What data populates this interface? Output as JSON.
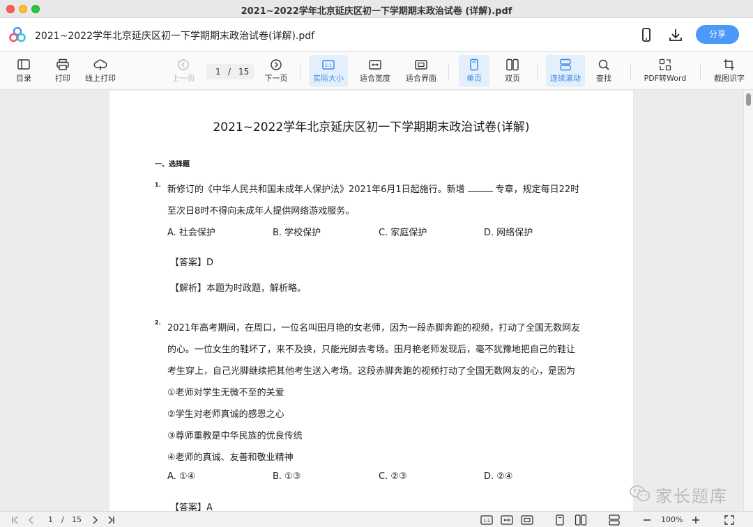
{
  "window": {
    "title": "2021~2022学年北京延庆区初一下学期期末政治试卷 (详解).pdf"
  },
  "header": {
    "doc_title": "2021~2022学年北京延庆区初一下学期期末政治试卷(详解).pdf",
    "share_label": "分享"
  },
  "toolbar": {
    "toc": "目录",
    "print": "打印",
    "online_print": "线上打印",
    "prev_page": "上一页",
    "current_page": "1",
    "page_sep": "/",
    "total_pages": "15",
    "next_page": "下一页",
    "actual_size": "实际大小",
    "fit_width": "适合宽度",
    "fit_page": "适合界面",
    "single_page": "单页",
    "double_page": "双页",
    "continuous_scroll": "连续滚动",
    "search": "查找",
    "pdf_to_word": "PDF转Word",
    "screenshot_ocr": "截图识字"
  },
  "document": {
    "title": "2021~2022学年北京延庆区初一下学期期末政治试卷(详解)",
    "section": "一、选择题",
    "q1": {
      "num": "1.",
      "line1a": "新修订的《中华人民共和国未成年人保护法》2021年6月1日起施行。新增",
      "line1b": "专章，规定每日22时",
      "line2": "至次日8时不得向未成年人提供网络游戏服务。",
      "options": [
        "A. 社会保护",
        "B. 学校保护",
        "C. 家庭保护",
        "D. 网络保护"
      ],
      "answer": "【答案】D",
      "analysis": "【解析】本题为时政题，解析略。"
    },
    "q2": {
      "num": "2.",
      "lines": [
        "2021年高考期间，在周口，一位名叫田月艳的女老师，因为一段赤脚奔跑的视频，打动了全国无数网友",
        "的心。一位女生的鞋坏了，来不及换，只能光脚去考场。田月艳老师发现后，毫不犹豫地把自己的鞋让",
        "考生穿上，自己光脚继续把其他考生送入考场。这段赤脚奔跑的视频打动了全国无数网友的心，是因为",
        "①老师对学生无微不至的关爱",
        "②学生对老师真诚的感恩之心",
        "③尊师重教是中华民族的优良传统",
        "④老师的真诚、友善和敬业精神"
      ],
      "options": [
        "A. ①④",
        "B. ①③",
        "C. ②③",
        "D. ②④"
      ],
      "answer": "【答案】A"
    }
  },
  "watermark": {
    "text": "家长题库"
  },
  "statusbar": {
    "current_page": "1",
    "page_sep": "/",
    "total_pages": "15",
    "zoom": "100%"
  }
}
